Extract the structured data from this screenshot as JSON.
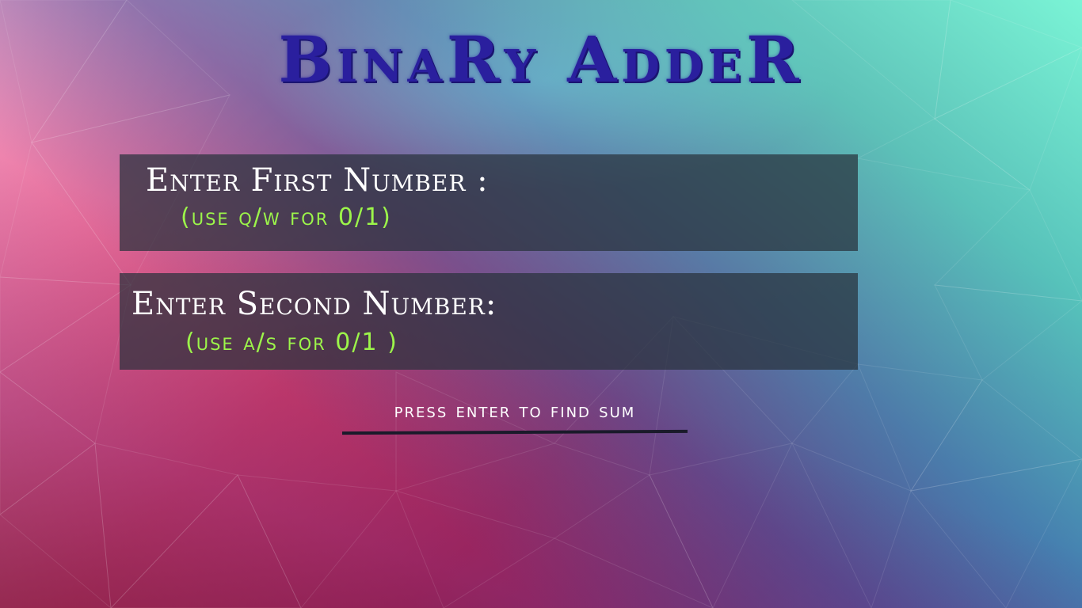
{
  "app": {
    "title": "BinaRy AddeR"
  },
  "first_number": {
    "label": "Enter First Number :",
    "hint": "(use q/w for 0/1)"
  },
  "second_number": {
    "label": "Enter Second Number:",
    "hint": "(use a/s for 0/1 )"
  },
  "action": {
    "prompt": "press enter to find sum"
  },
  "colors": {
    "title": "#2a1f9e",
    "panel": "#28323c",
    "hint": "#9cf54a",
    "label": "#ffffff"
  }
}
